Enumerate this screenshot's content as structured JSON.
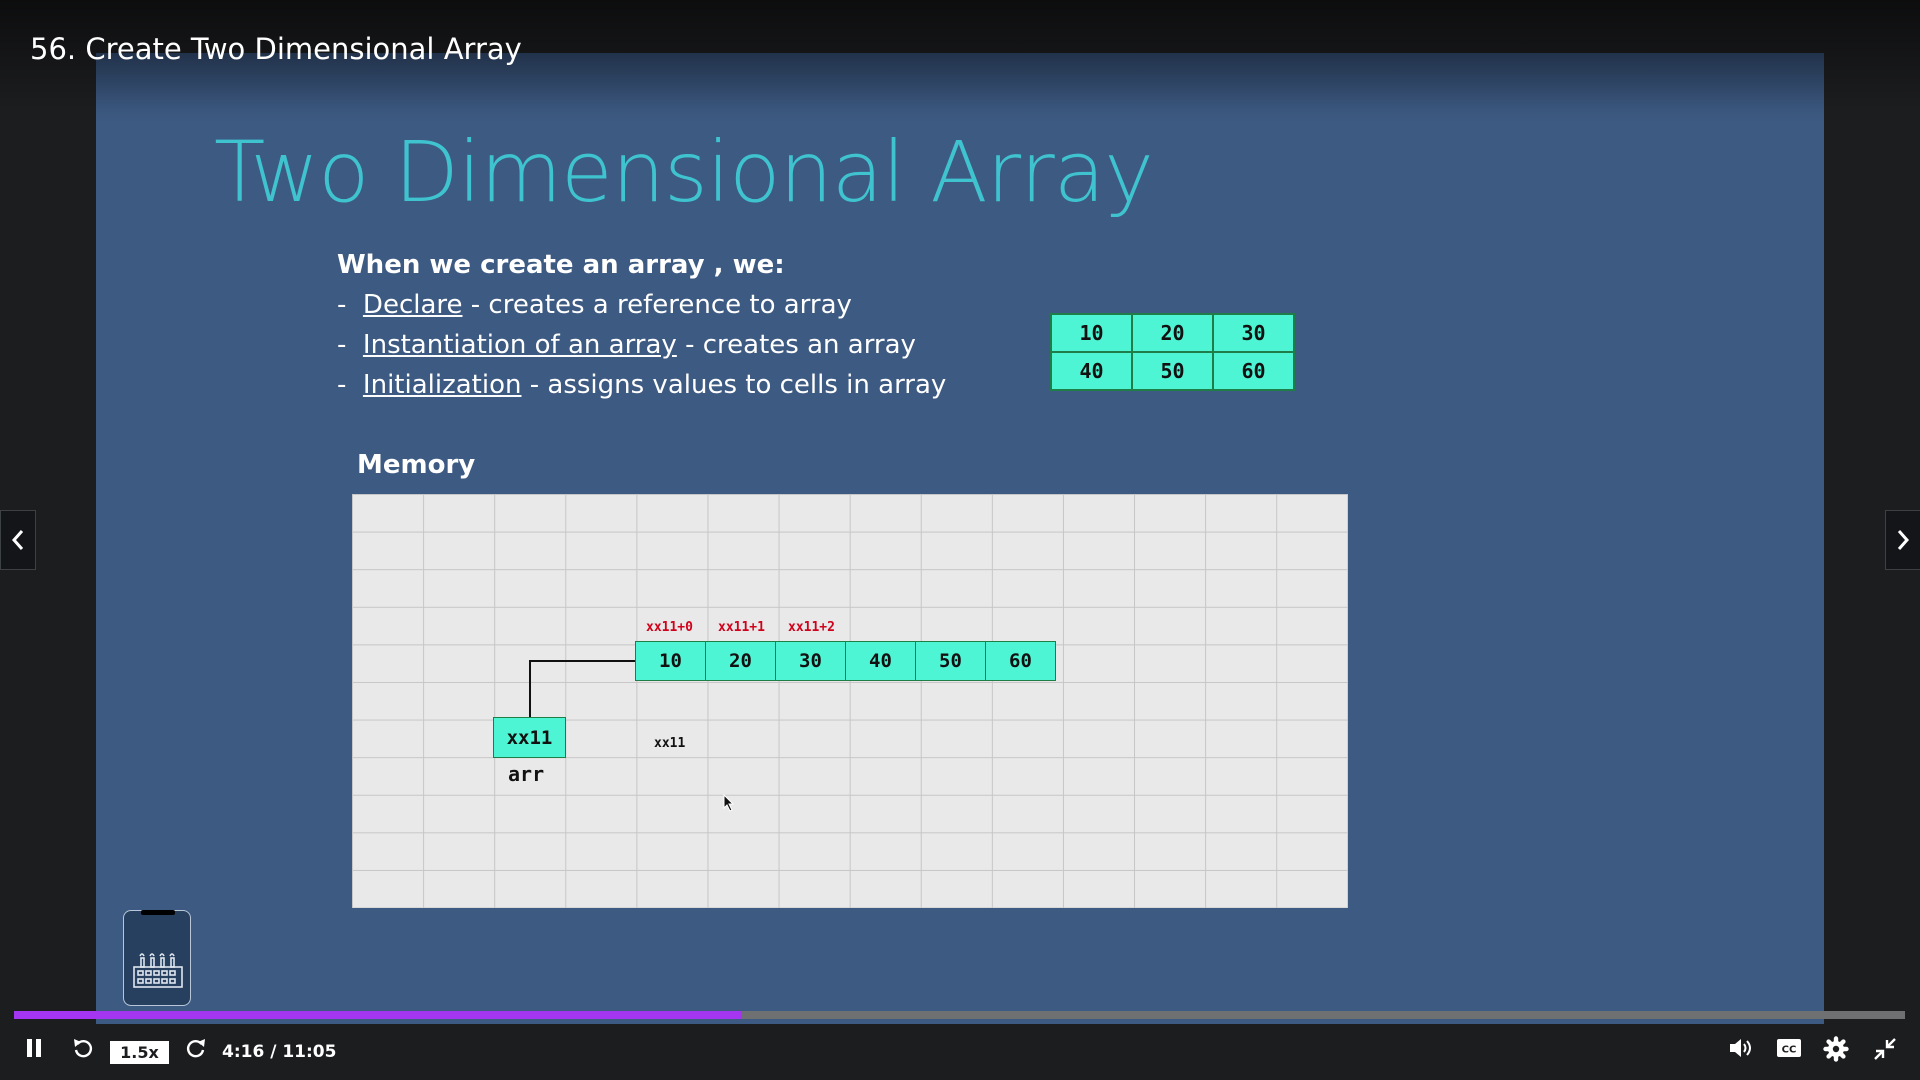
{
  "video": {
    "title": "56. Create Two Dimensional Array"
  },
  "slide": {
    "title": "Two Dimensional Array",
    "intro_heading": "When we create an array , we:",
    "bullets": [
      {
        "term": "Declare",
        "text": " - creates a reference to array"
      },
      {
        "term": "Instantiation of an array",
        "text": " - creates an array"
      },
      {
        "term": "Initialization",
        "text": " - assigns values to cells in array"
      }
    ],
    "table_2d": [
      [
        "10",
        "20",
        "30"
      ],
      [
        "40",
        "50",
        "60"
      ]
    ],
    "memory": {
      "label": "Memory",
      "cells": [
        "10",
        "20",
        "30",
        "40",
        "50",
        "60"
      ],
      "addresses": [
        "xx11+0",
        "xx11+1",
        "xx11+2"
      ],
      "base_address": "xx11",
      "reference_value": "xx11",
      "reference_name": "arr"
    }
  },
  "controls": {
    "speed": "1.5x",
    "time": "4:16 / 11:05",
    "progress_fraction": 0.385
  },
  "icons": {
    "play_pause": "pause-icon",
    "rewind": "rewind-icon",
    "forward": "forward-icon",
    "volume": "volume-icon",
    "captions": "captions-icon",
    "settings": "gear-icon",
    "exit_fullscreen": "exit-fullscreen-icon",
    "prev": "chevron-left-icon",
    "next": "chevron-right-icon"
  },
  "colors": {
    "accent": "#a435f0",
    "cell": "#4ef5d4",
    "title": "#3fc3cf",
    "slide_bg": "#3d5a82",
    "address": "#d0021b"
  }
}
